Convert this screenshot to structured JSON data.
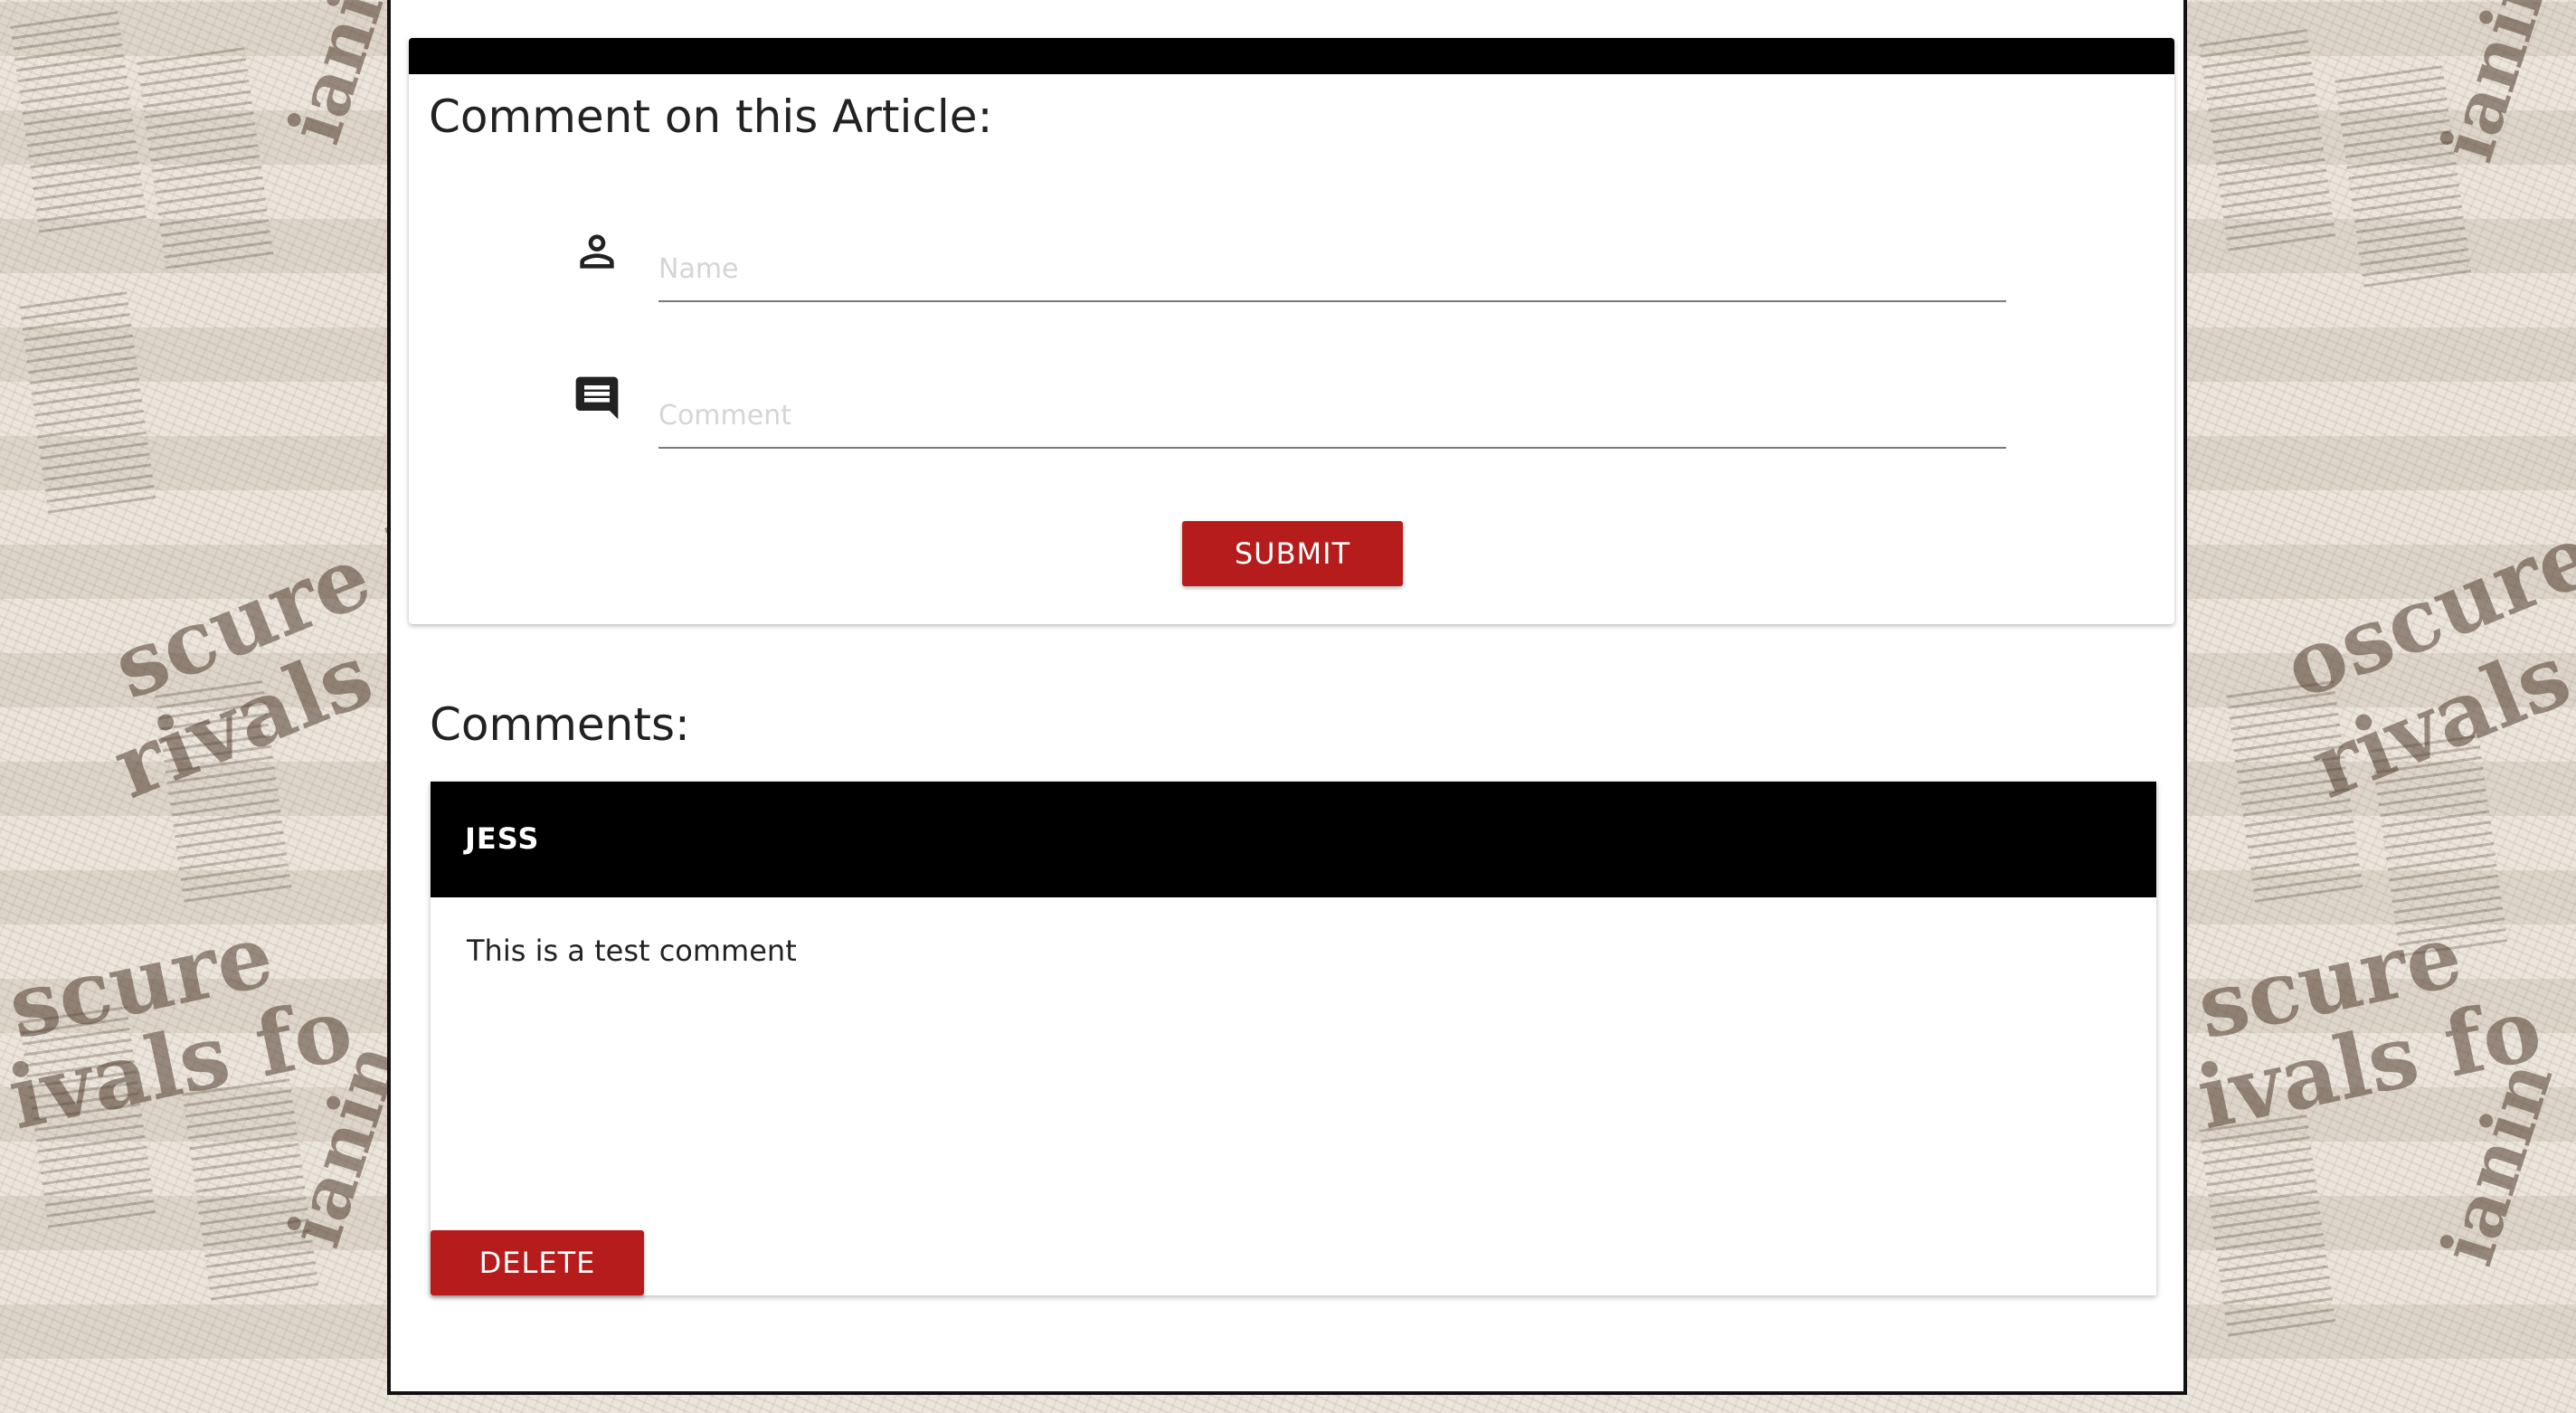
{
  "comment_form": {
    "title": "Comment on this Article:",
    "name_placeholder": "Name",
    "name_icon": "person-icon",
    "comment_placeholder": "Comment",
    "comment_icon": "comment-icon",
    "submit_label": "SUBMIT"
  },
  "comments_section": {
    "heading": "Comments:",
    "items": [
      {
        "author": "JESS",
        "text": "This is a test comment",
        "delete_label": "DELETE"
      }
    ]
  },
  "colors": {
    "accent": "#b71c1c",
    "header_bar": "#000000",
    "card_background": "#ffffff",
    "page_background": "#e4dcd1"
  }
}
